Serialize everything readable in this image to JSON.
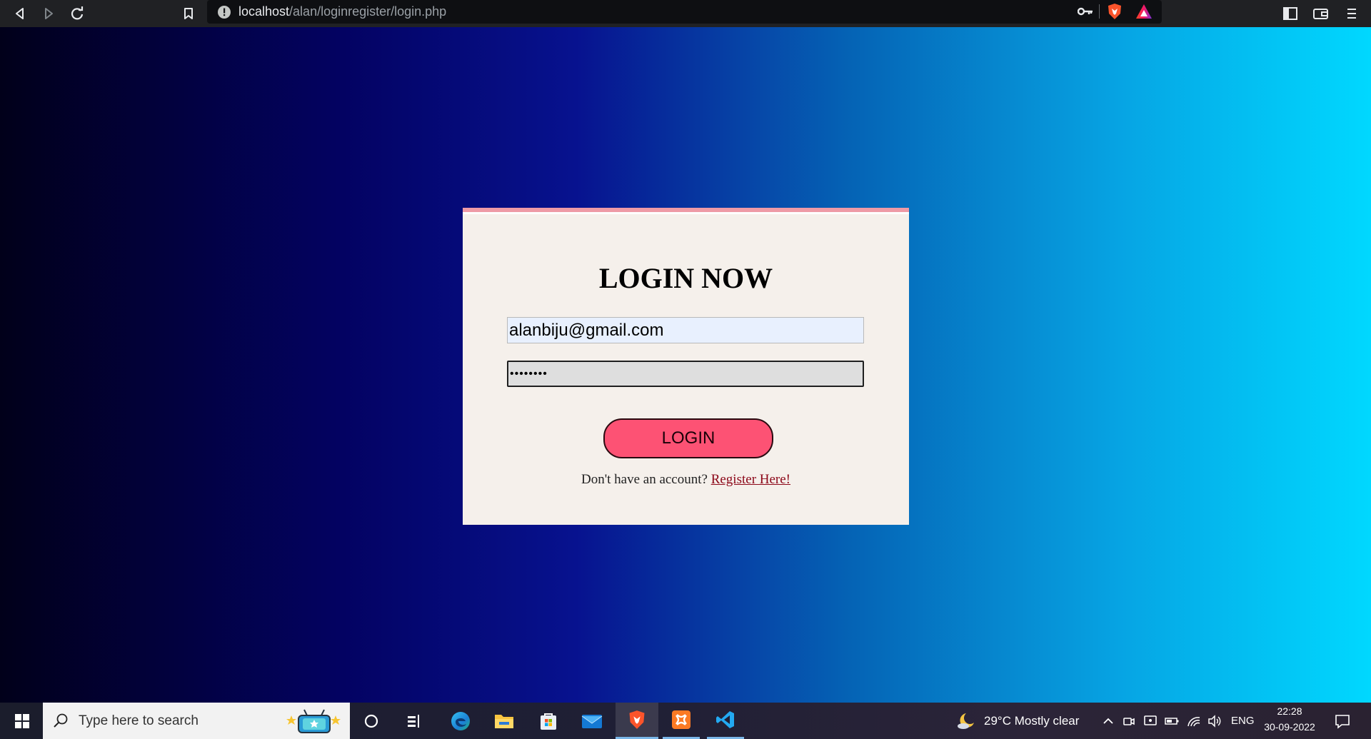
{
  "browser": {
    "url_host": "localhost",
    "url_path": "/alan/loginregister/login.php"
  },
  "login": {
    "title": "LOGIN NOW",
    "email_value": "alanbiju@gmail.com",
    "password_value": "pass1234",
    "button_label": "LOGIN",
    "register_prompt": "Don't have an account?",
    "register_link": "Register Here!"
  },
  "taskbar": {
    "search_placeholder": "Type here to search",
    "weather": "29°C  Mostly clear",
    "language": "ENG",
    "time": "22:28",
    "date": "30-09-2022"
  },
  "colors": {
    "card_background": "#f5f0eb",
    "card_top_border": "#ee9aa6",
    "login_button": "#fd5274",
    "register_link": "#8c0718"
  },
  "icons": [
    "back-icon",
    "forward-icon",
    "reload-icon",
    "bookmark-icon",
    "site-info-icon",
    "key-icon",
    "brave-shield-icon",
    "brave-rewards-icon",
    "sidebar-icon",
    "wallet-icon",
    "menu-icon",
    "windows-start-icon",
    "search-icon",
    "cortana-icon",
    "task-view-icon",
    "edge-icon",
    "file-explorer-icon",
    "store-icon",
    "mail-icon",
    "brave-icon",
    "xampp-icon",
    "vscode-icon",
    "weather-icon",
    "chevron-up-icon",
    "notification-icon"
  ]
}
